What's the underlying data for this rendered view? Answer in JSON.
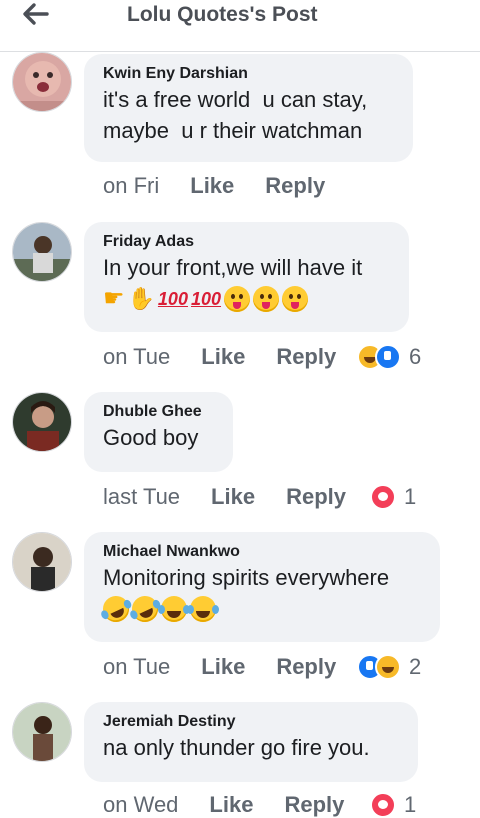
{
  "header": {
    "title": "Lolu Quotes's Post",
    "back_icon": "arrow-left-icon"
  },
  "colors": {
    "bubble": "#f0f2f5",
    "text": "#1c1e21",
    "meta": "#606770",
    "like_blue": "#1877f2",
    "love_red": "#f33e58",
    "haha_yellow": "#f7b928"
  },
  "comments": [
    {
      "author": "Kwin Eny Darshian",
      "text": "it's a free world  u can stay,\nmaybe  u r their watchman",
      "time": "on Fri",
      "like": "Like",
      "reply": "Reply",
      "reactions": "",
      "reaction_count": ""
    },
    {
      "author": "Friday Adas",
      "text": "In your front,we will have it",
      "emojis": [
        "pointing-hand",
        "ok-hand",
        "hundred",
        "hundred",
        "tongue-face",
        "tongue-face",
        "tongue-face"
      ],
      "time": "on Tue",
      "like": "Like",
      "reply": "Reply",
      "reactions": [
        "haha",
        "like"
      ],
      "reaction_count": "6"
    },
    {
      "author": "Dhuble Ghee",
      "text": "Good boy",
      "time": "last Tue",
      "like": "Like",
      "reply": "Reply",
      "reactions": [
        "love"
      ],
      "reaction_count": "1"
    },
    {
      "author": "Michael Nwankwo",
      "text": "Monitoring spirits everywhere",
      "emojis": [
        "rolling-laugh",
        "rolling-laugh",
        "tears-of-joy",
        "tears-of-joy"
      ],
      "time": "on Tue",
      "like": "Like",
      "reply": "Reply",
      "reactions": [
        "like",
        "haha"
      ],
      "reaction_count": "2"
    },
    {
      "author": "Jeremiah Destiny",
      "text": "na only thunder go fire you.",
      "time": "on Wed",
      "like": "Like",
      "reply": "Reply",
      "reactions": [
        "love"
      ],
      "reaction_count": "1"
    }
  ]
}
